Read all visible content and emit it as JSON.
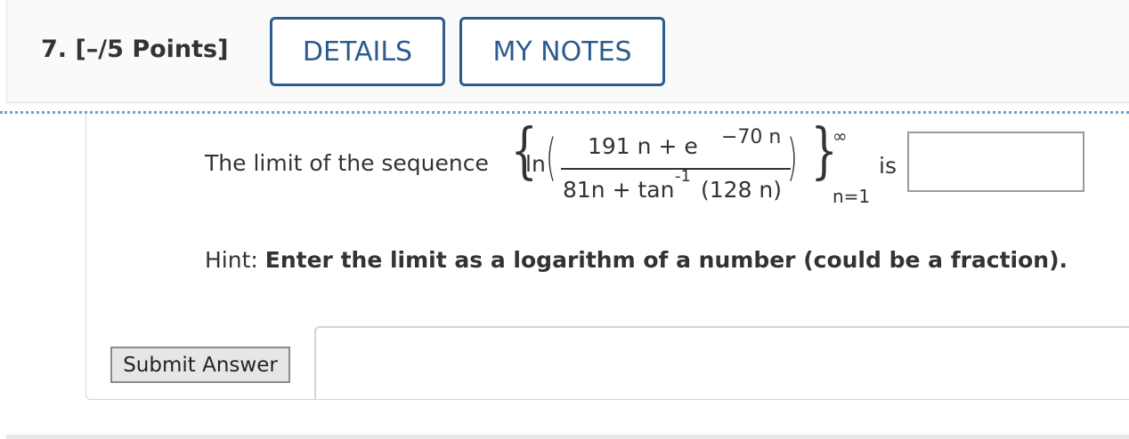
{
  "question": {
    "number_label": "7.",
    "points_label": "[–/5 Points]",
    "details_button": "DETAILS",
    "notes_button": "MY NOTES"
  },
  "problem": {
    "prompt": "The limit of the sequence",
    "brace_open": "{",
    "brace_close": "}",
    "func": "ln",
    "paren_open": "(",
    "paren_close": ")",
    "numerator": "191 n + e",
    "numerator_exponent": "−70 n",
    "denominator_lead": "81n + tan",
    "denominator_exponent": "-1",
    "denominator_tail": "(128 n)",
    "upper_limit": "∞",
    "lower_limit": "n=1",
    "connector": "is",
    "answer_value": ""
  },
  "hint": {
    "label": "Hint: ",
    "text": "Enter the limit as a logarithm of a number (could be a fraction)."
  },
  "actions": {
    "submit_label": "Submit Answer"
  },
  "colors": {
    "accent": "#2b5c8f",
    "dotted_rule": "#6aa3d6",
    "text": "#333333"
  }
}
